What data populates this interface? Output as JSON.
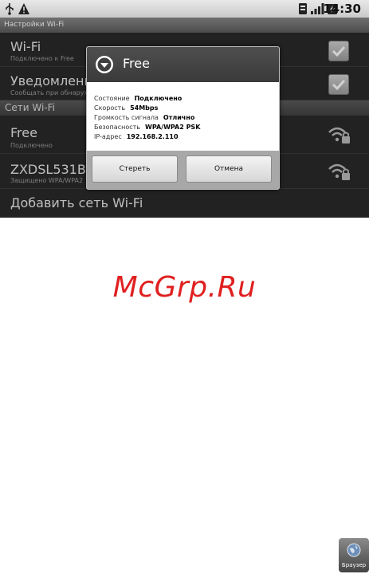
{
  "statusbar": {
    "time": "14:30"
  },
  "titlebar": {
    "title": "Настройки Wi-Fi"
  },
  "settings": [
    {
      "title": "Wi-Fi",
      "subtitle": "Подключено к Free"
    },
    {
      "title": "Уведомления о сетях",
      "subtitle": "Сообщать при обнаружении открытой сети"
    }
  ],
  "section": {
    "label": "Сети Wi-Fi"
  },
  "networks": [
    {
      "name": "Free",
      "status": "Подключено"
    },
    {
      "name": "ZXDSL531BII-",
      "status": "Защищено WPA/WPA2"
    }
  ],
  "add_network": {
    "label": "Добавить сеть Wi-Fi"
  },
  "dialog": {
    "title": "Free",
    "rows": [
      {
        "label": "Состояние",
        "value": "Подключено"
      },
      {
        "label": "Скорость",
        "value": "54Mbps"
      },
      {
        "label": "Громкость сигнала",
        "value": "Отлично"
      },
      {
        "label": "Безопасность",
        "value": "WPA/WPA2 PSK"
      },
      {
        "label": "IP-адрес",
        "value": "192.168.2.110"
      }
    ],
    "forget_label": "Стереть",
    "cancel_label": "Отмена"
  },
  "watermark": "McGrp.Ru",
  "browser": {
    "label": "Браузер"
  },
  "icons": [
    "usb-icon",
    "warning-icon",
    "sim-icon",
    "signal-icon",
    "battery-icon",
    "wifi-lock-icon",
    "dropdown-circle-icon",
    "globe-icon"
  ],
  "colors": {
    "watermark": "#e02020",
    "accent": "#3a3a3a"
  }
}
